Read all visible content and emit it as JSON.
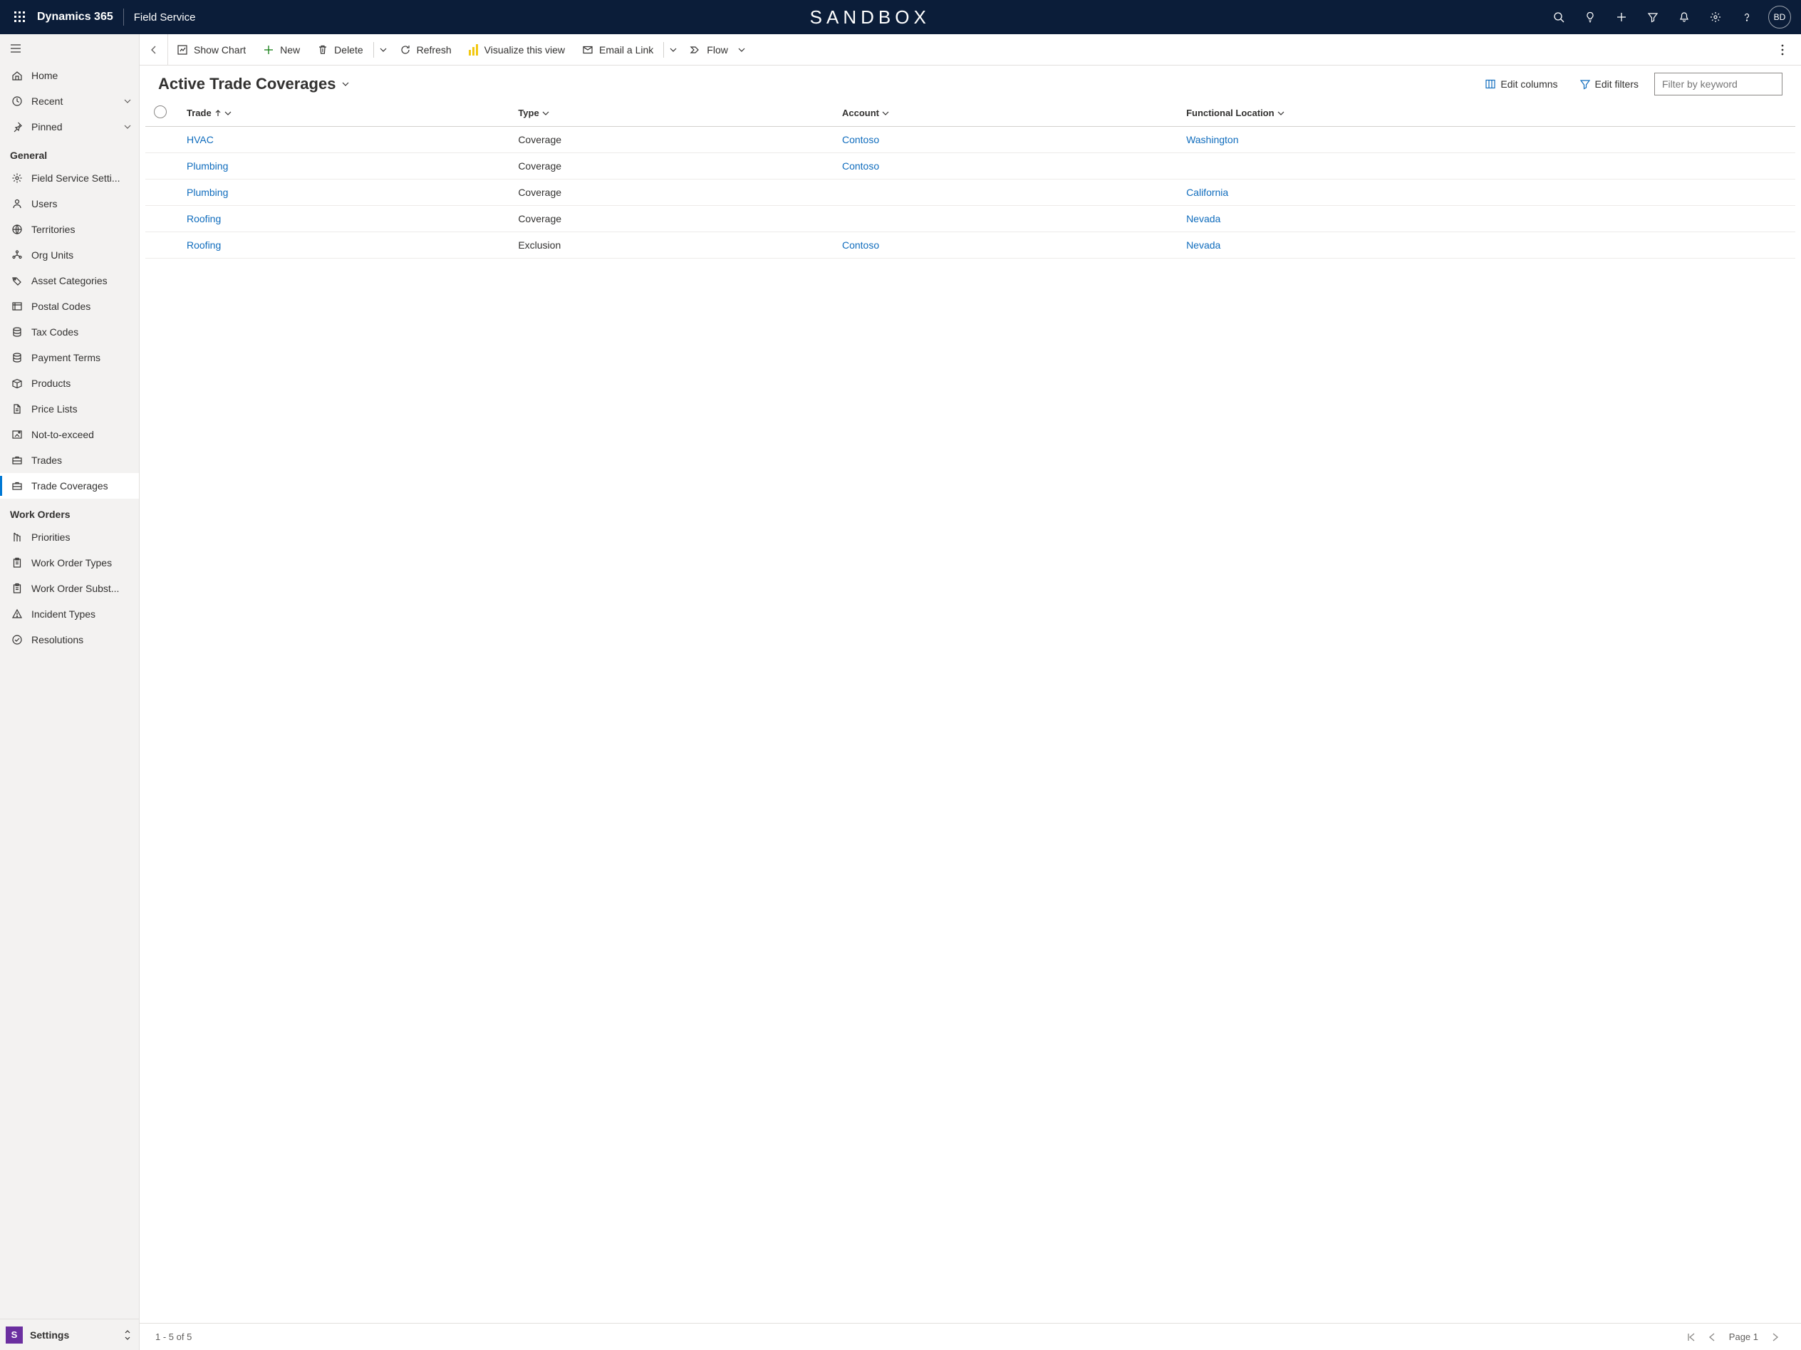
{
  "topbar": {
    "brand": "Dynamics 365",
    "app": "Field Service",
    "env_banner": "SANDBOX",
    "user_initials": "BD"
  },
  "sidebar": {
    "top": [
      {
        "icon": "home",
        "label": "Home"
      },
      {
        "icon": "clock",
        "label": "Recent",
        "expandable": true
      },
      {
        "icon": "pin",
        "label": "Pinned",
        "expandable": true
      }
    ],
    "section_general_header": "General",
    "general": [
      {
        "icon": "gear",
        "label": "Field Service Setti..."
      },
      {
        "icon": "person",
        "label": "Users"
      },
      {
        "icon": "globe",
        "label": "Territories"
      },
      {
        "icon": "org",
        "label": "Org Units"
      },
      {
        "icon": "tag",
        "label": "Asset Categories"
      },
      {
        "icon": "postal",
        "label": "Postal Codes"
      },
      {
        "icon": "db",
        "label": "Tax Codes"
      },
      {
        "icon": "db",
        "label": "Payment Terms"
      },
      {
        "icon": "box",
        "label": "Products"
      },
      {
        "icon": "doc",
        "label": "Price Lists"
      },
      {
        "icon": "nte",
        "label": "Not-to-exceed"
      },
      {
        "icon": "briefcase",
        "label": "Trades"
      },
      {
        "icon": "briefcase",
        "label": "Trade Coverages",
        "selected": true
      }
    ],
    "section_wo_header": "Work Orders",
    "work_orders": [
      {
        "icon": "priority",
        "label": "Priorities"
      },
      {
        "icon": "clip",
        "label": "Work Order Types"
      },
      {
        "icon": "clip",
        "label": "Work Order Subst..."
      },
      {
        "icon": "warn",
        "label": "Incident Types"
      },
      {
        "icon": "check",
        "label": "Resolutions"
      }
    ],
    "area": {
      "tile": "S",
      "label": "Settings"
    }
  },
  "cmdbar": {
    "show_chart": "Show Chart",
    "new": "New",
    "delete": "Delete",
    "refresh": "Refresh",
    "visualize": "Visualize this view",
    "email_link": "Email a Link",
    "flow": "Flow"
  },
  "view": {
    "title": "Active Trade Coverages",
    "edit_columns": "Edit columns",
    "edit_filters": "Edit filters",
    "filter_placeholder": "Filter by keyword"
  },
  "columns": {
    "trade": "Trade",
    "type": "Type",
    "account": "Account",
    "loc": "Functional Location"
  },
  "rows": [
    {
      "trade": "HVAC",
      "type": "Coverage",
      "account": "Contoso",
      "loc": "Washington"
    },
    {
      "trade": "Plumbing",
      "type": "Coverage",
      "account": "Contoso",
      "loc": ""
    },
    {
      "trade": "Plumbing",
      "type": "Coverage",
      "account": "",
      "loc": "California"
    },
    {
      "trade": "Roofing",
      "type": "Coverage",
      "account": "",
      "loc": "Nevada"
    },
    {
      "trade": "Roofing",
      "type": "Exclusion",
      "account": "Contoso",
      "loc": "Nevada"
    }
  ],
  "status": {
    "range": "1 - 5 of 5",
    "page": "Page 1"
  }
}
